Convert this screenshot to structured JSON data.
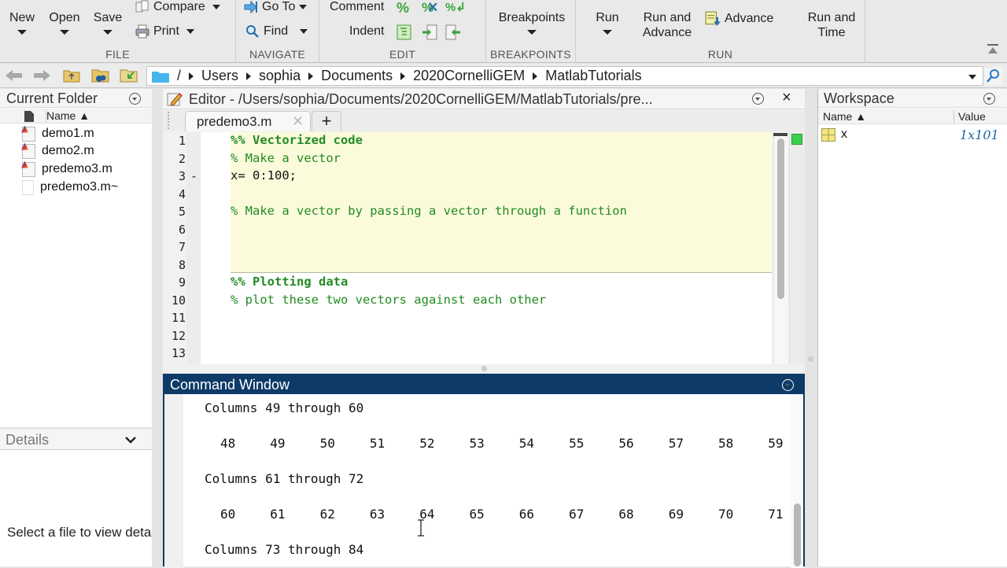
{
  "toolstrip": {
    "file": {
      "label": "FILE",
      "new": "New",
      "open": "Open",
      "save": "Save",
      "compare": "Compare",
      "print": "Print"
    },
    "navigate": {
      "label": "NAVIGATE",
      "goto": "Go To",
      "find": "Find"
    },
    "edit": {
      "label": "EDIT",
      "comment": "Comment",
      "indent": "Indent"
    },
    "breakpoints": {
      "label": "BREAKPOINTS",
      "breakpoints": "Breakpoints"
    },
    "run": {
      "label": "RUN",
      "run": "Run",
      "run_and_advance_1": "Run and",
      "run_and_advance_2": "Advance",
      "advance": "Advance",
      "run_and_time_1": "Run and",
      "run_and_time_2": "Time"
    }
  },
  "address": {
    "crumbs": [
      "/",
      "Users",
      "sophia",
      "Documents",
      "2020CornelliGEM",
      "MatlabTutorials"
    ]
  },
  "current_folder": {
    "title": "Current Folder",
    "column_name": "Name ▲",
    "files": [
      {
        "name": "demo1.m",
        "type": "m-file"
      },
      {
        "name": "demo2.m",
        "type": "m-file"
      },
      {
        "name": "predemo3.m",
        "type": "m-file"
      },
      {
        "name": "predemo3.m~",
        "type": "plain-file"
      }
    ]
  },
  "details": {
    "title": "Details",
    "message": "Select a file to view details"
  },
  "editor": {
    "title": "Editor - /Users/sophia/Documents/2020CornelliGEM/MatlabTutorials/pre...",
    "tab": "predemo3.m",
    "add_tab": "+",
    "close": "×",
    "lines": [
      {
        "n": "1",
        "text": "%% Vectorized code",
        "style": "section",
        "marker": ""
      },
      {
        "n": "2",
        "text": "% Make a vector",
        "style": "comment",
        "marker": ""
      },
      {
        "n": "3",
        "text": "x= 0:100;",
        "style": "code",
        "marker": "-"
      },
      {
        "n": "4",
        "text": "",
        "style": "code",
        "marker": ""
      },
      {
        "n": "5",
        "text": "% Make a vector by passing a vector through a function",
        "style": "comment",
        "marker": ""
      },
      {
        "n": "6",
        "text": "",
        "style": "code",
        "marker": ""
      },
      {
        "n": "7",
        "text": "",
        "style": "code",
        "marker": ""
      },
      {
        "n": "8",
        "text": "",
        "style": "code",
        "marker": ""
      },
      {
        "n": "9",
        "text": "%% Plotting data",
        "style": "section",
        "marker": ""
      },
      {
        "n": "10",
        "text": "% plot these two vectors against each other",
        "style": "comment",
        "marker": ""
      },
      {
        "n": "11",
        "text": "",
        "style": "code",
        "marker": ""
      },
      {
        "n": "12",
        "text": "",
        "style": "code",
        "marker": ""
      },
      {
        "n": "13",
        "text": "",
        "style": "code",
        "marker": ""
      }
    ]
  },
  "command_window": {
    "title": "Command Window",
    "output": [
      {
        "kind": "header",
        "text": "Columns 49 through 60"
      },
      {
        "kind": "values",
        "values": [
          "48",
          "49",
          "50",
          "51",
          "52",
          "53",
          "54",
          "55",
          "56",
          "57",
          "58",
          "59"
        ]
      },
      {
        "kind": "header",
        "text": "Columns 61 through 72"
      },
      {
        "kind": "values",
        "values": [
          "60",
          "61",
          "62",
          "63",
          "64",
          "65",
          "66",
          "67",
          "68",
          "69",
          "70",
          "71"
        ]
      },
      {
        "kind": "header",
        "text": "Columns 73 through 84"
      }
    ]
  },
  "workspace": {
    "title": "Workspace",
    "col_name": "Name ▲",
    "col_value": "Value",
    "variables": [
      {
        "name": "x",
        "value": "1x101"
      }
    ]
  },
  "colors": {
    "command_header": "#0e3a68",
    "cell_highlight": "#fbfbdc",
    "comment_green": "#228b22",
    "status_green": "#3ccf4e"
  }
}
